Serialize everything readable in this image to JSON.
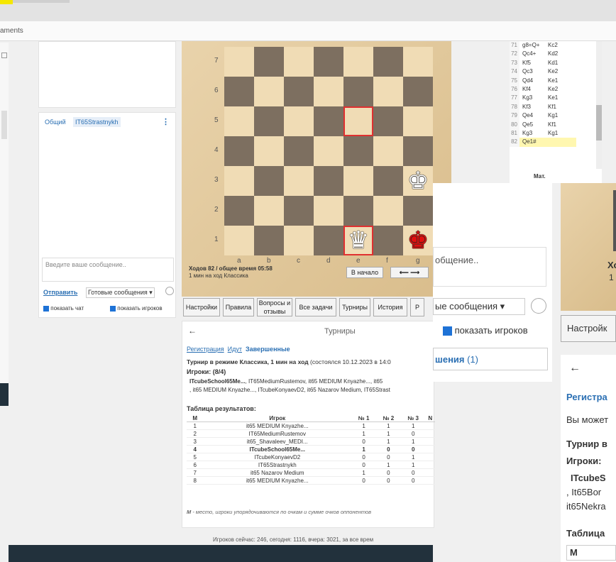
{
  "browser": {
    "address_fragment": "aments"
  },
  "chat": {
    "tab_general": "Общий",
    "tab_user": "IT65Strastnykh",
    "placeholder": "Введите ваше сообщение..",
    "send": "Отправить",
    "ready": "Готовые сообщения ▾",
    "show_chat": "показать чат",
    "show_players": "показать игроков"
  },
  "board": {
    "ranks": [
      "7",
      "6",
      "5",
      "4",
      "3",
      "2",
      "1"
    ],
    "files": [
      "a",
      "b",
      "c",
      "d",
      "e",
      "f",
      "g"
    ],
    "moves_info": "Ходов 82 / общее время 05:58",
    "mode_info": "1 мин на ход Классика",
    "to_start": "В начало",
    "arrows": "⟵ ⟶",
    "pieces": {
      "white_king": "♚",
      "white_queen": "♛",
      "black_king": "♚"
    }
  },
  "tabs": [
    "Настройки",
    "Правила",
    "Вопросы и отзывы",
    "Все задачи",
    "Турниры",
    "История",
    "Р"
  ],
  "moves": [
    [
      "71",
      "g8=Q+",
      "Kc2"
    ],
    [
      "72",
      "Qc4+",
      "Kd2"
    ],
    [
      "73",
      "Kf5",
      "Kd1"
    ],
    [
      "74",
      "Qc3",
      "Ke2"
    ],
    [
      "75",
      "Qd4",
      "Ke1"
    ],
    [
      "76",
      "Kf4",
      "Ke2"
    ],
    [
      "77",
      "Kg3",
      "Ke1"
    ],
    [
      "78",
      "Kf3",
      "Kf1"
    ],
    [
      "79",
      "Qe4",
      "Kg1"
    ],
    [
      "80",
      "Qe5",
      "Kf1"
    ],
    [
      "81",
      "Kg3",
      "Kg1"
    ],
    [
      "82",
      "Qe1#",
      ""
    ]
  ],
  "mate": "Мат.",
  "tournaments": {
    "back": "←",
    "title": "Турниры",
    "nav": [
      "Регистрация",
      "Идут",
      "Завершенные"
    ],
    "header_bold": "Турнир в режиме Классика, 1 мин на ход",
    "header_rest": "(состоялся 10.12.2023 в 14:0",
    "players_label": "Игроки: (8/4)",
    "players_line1_bold": "ITcubeSchool65Me...",
    "players_line1_rest": ", IT65MediumRustemov, it65 MEDIUM Knyazhe..., it65",
    "players_line2": ", it65 MEDIUM Knyazhe..., ITcubeKonyaevD2, it65 Nazarov Medium, IT65Strast",
    "results_label": "Таблица результатов:",
    "cols": [
      "М",
      "Игрок",
      "№ 1",
      "№ 2",
      "№ 3",
      "N"
    ],
    "rows": [
      [
        "1",
        "it65 MEDIUM Knyazhe...",
        "1",
        "1",
        "1"
      ],
      [
        "2",
        "IT65MediumRustemov",
        "1",
        "1",
        "0"
      ],
      [
        "3",
        "it65_Shavaleev_MEDI...",
        "0",
        "1",
        "1"
      ],
      [
        "4",
        "ITcubeSchool65Me...",
        "1",
        "0",
        "0"
      ],
      [
        "5",
        "ITcubeKonyaevD2",
        "0",
        "0",
        "1"
      ],
      [
        "6",
        "IT65Strastnykh",
        "0",
        "1",
        "1"
      ],
      [
        "7",
        "it65 Nazarov Medium",
        "1",
        "0",
        "0"
      ],
      [
        "8",
        "it65 MEDIUM Knyazhe...",
        "0",
        "0",
        "0"
      ]
    ],
    "note_bold": "М",
    "note": " - место, игроки упорядочиваются по очкам и сумме очков оппонентов",
    "online": "Игроков сейчас: 246, сегодня: 1116, вчера: 3021, за все врем"
  },
  "overlay": {
    "msg": "общение..",
    "ready": "ые сообщения ▾",
    "show_players": "показать игроков",
    "tab": "шения",
    "tab_count": "(1)"
  },
  "right": {
    "kho": "Хо",
    "one": "1",
    "settings": "Настройк",
    "back": "←",
    "reg": "Регистра",
    "may": "Вы может",
    "tour": "Турнир в",
    "players": "Игроки:",
    "p1": "ITcubeS",
    "p2": ", It65Bor",
    "p3": "it65Nekra",
    "table": "Таблица",
    "m": "М"
  }
}
